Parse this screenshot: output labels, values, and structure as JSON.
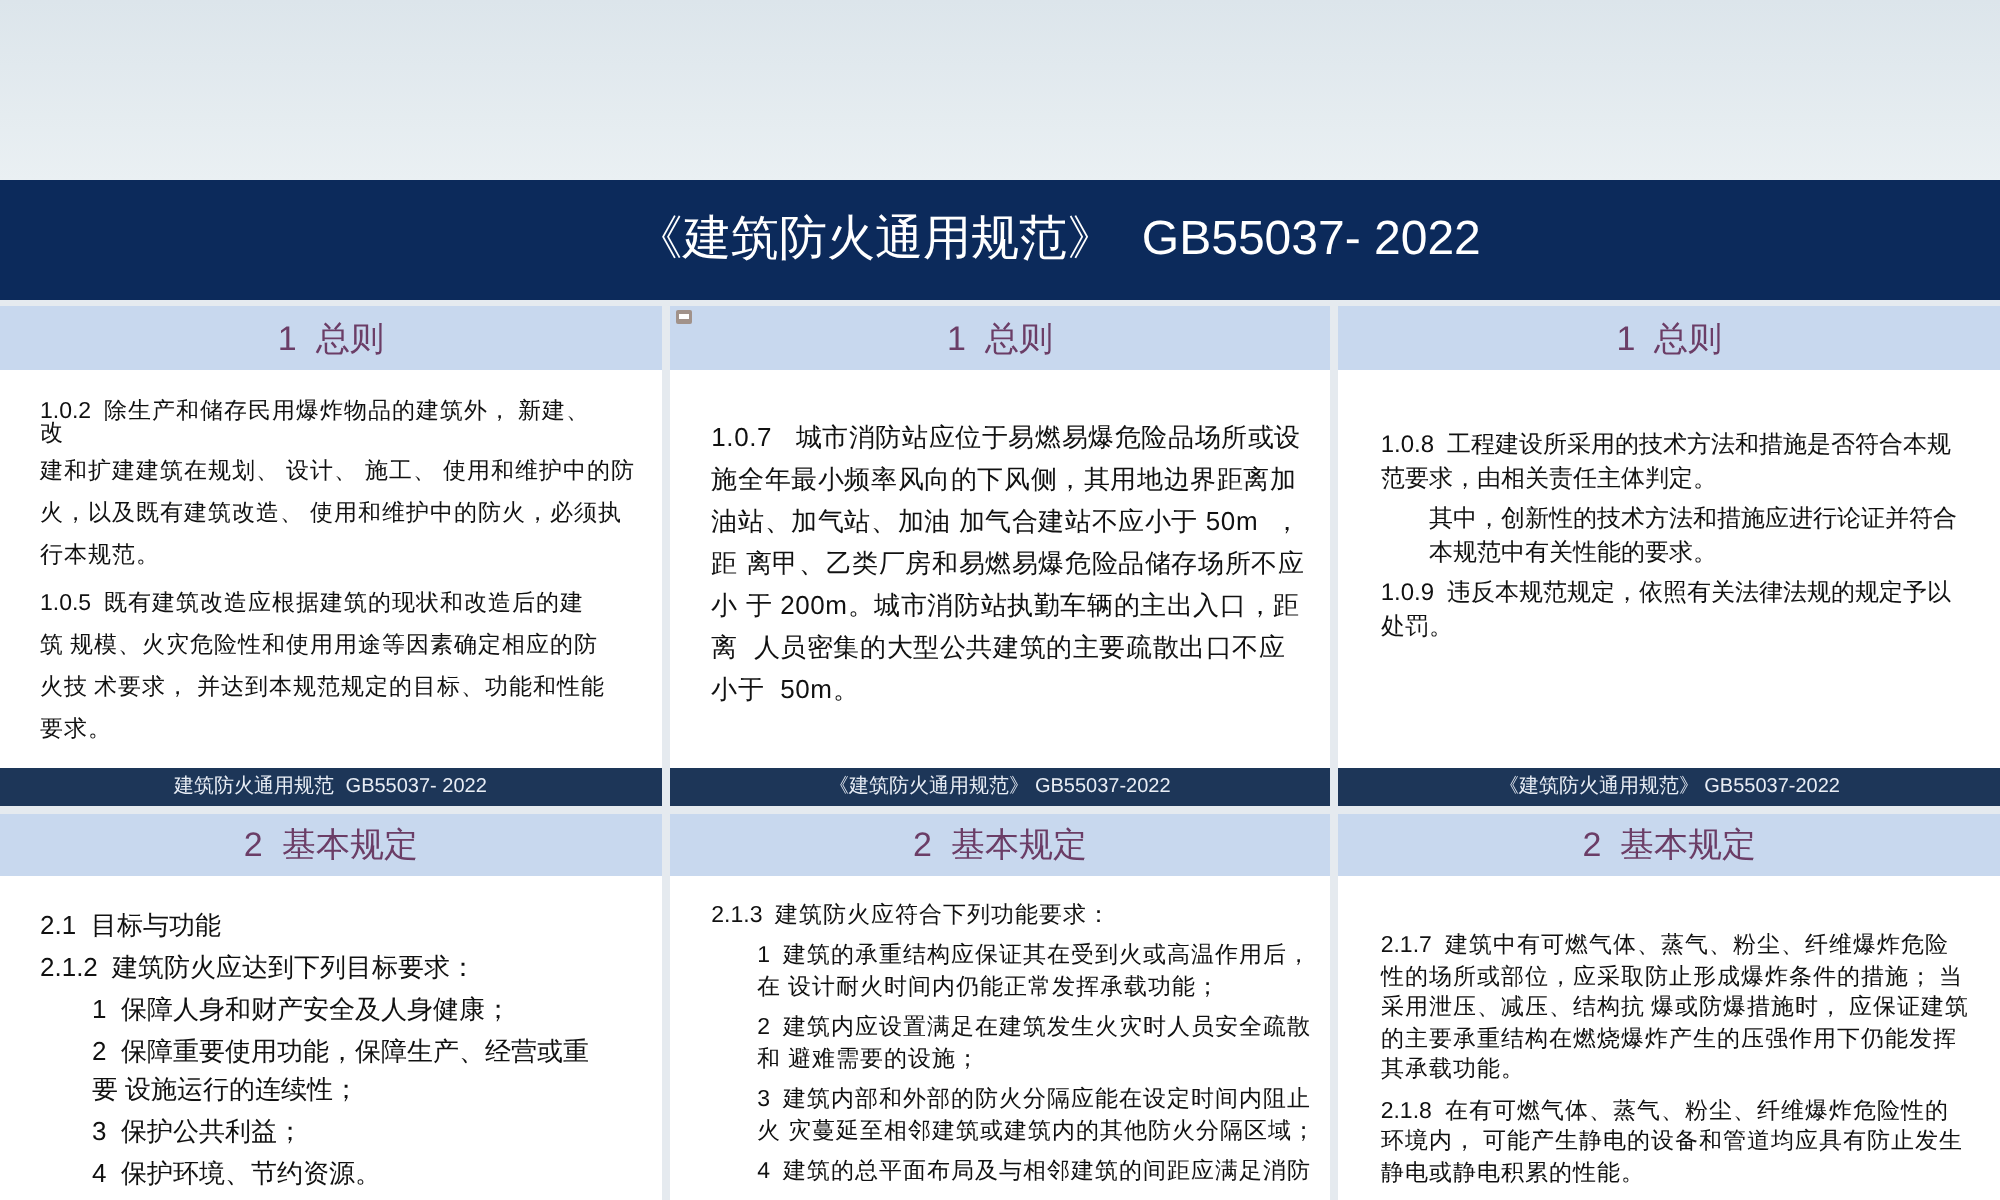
{
  "banner": {
    "title": "《建筑防火通用规范》  GB55037- 2022"
  },
  "slides": [
    {
      "heading": "1  总则",
      "comment_marker": false,
      "paragraphs": [
        {
          "kind": "tight",
          "lines": [
            "1.0.2  除生产和储存民用爆炸物品的建筑外， 新建、",
            "改"
          ]
        },
        {
          "kind": "plain",
          "lines": [
            "建和扩建建筑在规划、 设计、 施工、 使用和维护中的防",
            "火，以及既有建筑改造、 使用和维护中的防火，必须执",
            "行本规范。"
          ]
        },
        {
          "kind": "plain",
          "lines": [
            "1.0.5  既有建筑改造应根据建筑的现状和改造后的建",
            "筑 规模、火灾危险性和使用用途等因素确定相应的防",
            "火技 术要求， 并达到本规范规定的目标、功能和性能",
            "要求。"
          ]
        }
      ],
      "footer": "建筑防火通用规范  GB55037- 2022"
    },
    {
      "heading": "1  总则",
      "comment_marker": true,
      "paragraphs": [
        {
          "kind": "plain",
          "lines": [
            "1.0.7   城市消防站应位于易燃易爆危险品场所或设",
            "施全年最小频率风向的下风侧，其用地边界距离加",
            "油站、加气站、加油 加气合建站不应小于 50m  ，",
            "距 离甲、乙类厂房和易燃易爆危险品储存场所不应",
            "小 于 200m。城市消防站执勤车辆的主出入口，距",
            "离  人员密集的大型公共建筑的主要疏散出口不应",
            "小于  50m。"
          ]
        }
      ],
      "footer": "《建筑防火通用规范》 GB55037-2022"
    },
    {
      "heading": "1  总则",
      "comment_marker": false,
      "paragraphs": [
        {
          "kind": "plain",
          "lines": [
            "1.0.8  工程建设所采用的技术方法和措施是否符合本规",
            "范要求，由相关责任主体判定。"
          ]
        },
        {
          "kind": "indented",
          "lines": [
            "其中，创新性的技术方法和措施应进行论证并符合",
            "本规范中有关性能的要求。"
          ]
        },
        {
          "kind": "plain",
          "lines": [
            "1.0.9  违反本规范规定，依照有关法律法规的规定予以",
            "处罚。"
          ]
        }
      ],
      "footer": "《建筑防火通用规范》 GB55037-2022"
    },
    {
      "heading": "2  基本规定",
      "comment_marker": false,
      "paragraphs": [
        {
          "kind": "plain",
          "lines": [
            "2.1  目标与功能"
          ]
        },
        {
          "kind": "plain",
          "lines": [
            "2.1.2  建筑防火应达到下列目标要求："
          ]
        },
        {
          "kind": "indented",
          "lines": [
            "1  保障人身和财产安全及人身健康；"
          ]
        },
        {
          "kind": "indented",
          "lines": [
            "2  保障重要使用功能，保障生产、经营或重",
            "要 设施运行的连续性；"
          ]
        },
        {
          "kind": "indented",
          "lines": [
            "3  保护公共利益；"
          ]
        },
        {
          "kind": "indented",
          "lines": [
            "4  保护环境、节约资源。"
          ]
        }
      ]
    },
    {
      "heading": "2  基本规定",
      "comment_marker": false,
      "paragraphs": [
        {
          "kind": "plain",
          "lines": [
            "2.1.3  建筑防火应符合下列功能要求："
          ]
        },
        {
          "kind": "indented",
          "lines": [
            "1  建筑的承重结构应保证其在受到火或高温作用后，",
            "在 设计耐火时间内仍能正常发挥承载功能；"
          ]
        },
        {
          "kind": "indented",
          "lines": [
            "2  建筑内应设置满足在建筑发生火灾时人员安全疏散",
            "和 避难需要的设施；"
          ]
        },
        {
          "kind": "indented",
          "lines": [
            "3  建筑内部和外部的防火分隔应能在设定时间内阻止",
            "火 灾蔓延至相邻建筑或建筑内的其他防火分隔区域；"
          ]
        },
        {
          "kind": "indented",
          "lines": [
            "4  建筑的总平面布局及与相邻建筑的间距应满足消防"
          ]
        }
      ]
    },
    {
      "heading": "2  基本规定",
      "comment_marker": false,
      "paragraphs": [
        {
          "kind": "plain",
          "lines": [
            "2.1.7  建筑中有可燃气体、蒸气、粉尘、纤维爆炸危险",
            "性的场所或部位，应采取防止形成爆炸条件的措施； 当",
            "采用泄压、减压、结构抗 爆或防爆措施时， 应保证建筑",
            "的主要承重结构在燃烧爆炸产生的压强作用下仍能发挥",
            "其承载功能。"
          ]
        },
        {
          "kind": "plain",
          "lines": [
            "2.1.8  在有可燃气体、蒸气、粉尘、纤维爆炸危险性的",
            "环境内， 可能产生静电的设备和管道均应具有防止发生",
            "静电或静电积累的性能。"
          ]
        }
      ]
    }
  ]
}
